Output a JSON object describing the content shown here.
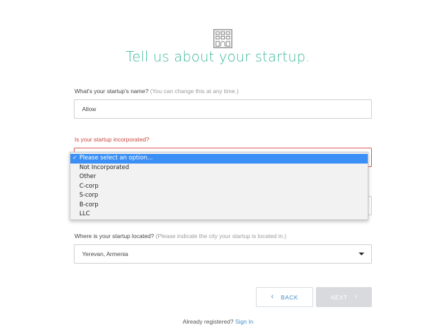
{
  "header": {
    "title": "Tell us about your startup.",
    "logo_icon": "building-icon",
    "accent_color": "#3db89a"
  },
  "name_field": {
    "label": "What's your startup's name?",
    "hint": "(You can change this at any time.)",
    "value": "Allow"
  },
  "incorporated_field": {
    "label": "Is your startup incorporated?",
    "status": "error",
    "error_color": "#c9473f",
    "options": [
      "Please select an option...",
      "Not Incorporated",
      "Other",
      "C-corp",
      "S-corp",
      "B-corp",
      "LLC"
    ],
    "selected_index": 0,
    "check_mark": "✓"
  },
  "location_field": {
    "label": "Where is your startup located?",
    "hint": "(Please indicate the city your startup is located in.)",
    "value": "Yerevan, Armenia"
  },
  "buttons": {
    "back_label": "BACK",
    "next_label": "NEXT",
    "back_icon": "chevron-left-icon",
    "next_icon": "chevron-right-icon"
  },
  "footer": {
    "text": "Already registered?",
    "link": "Sign In"
  }
}
